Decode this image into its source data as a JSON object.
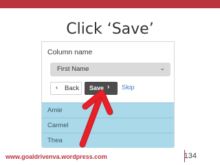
{
  "slide": {
    "title": "Click ‘Save’",
    "footer_url": "www.goaldrivenva.wordpress.com",
    "page_number": "134",
    "accent_color": "#b9343f"
  },
  "panel": {
    "heading": "Column name",
    "dropdown": {
      "value": "First Name",
      "caret_icon": "chevron-down-icon"
    },
    "buttons": {
      "back_label": "Back",
      "save_label": "Save",
      "skip_label": "Skip"
    },
    "list_items": [
      "Amie",
      "Carmel",
      "Thea"
    ]
  },
  "annotation": {
    "arrow_color": "#e8202a",
    "target": "save-button"
  }
}
